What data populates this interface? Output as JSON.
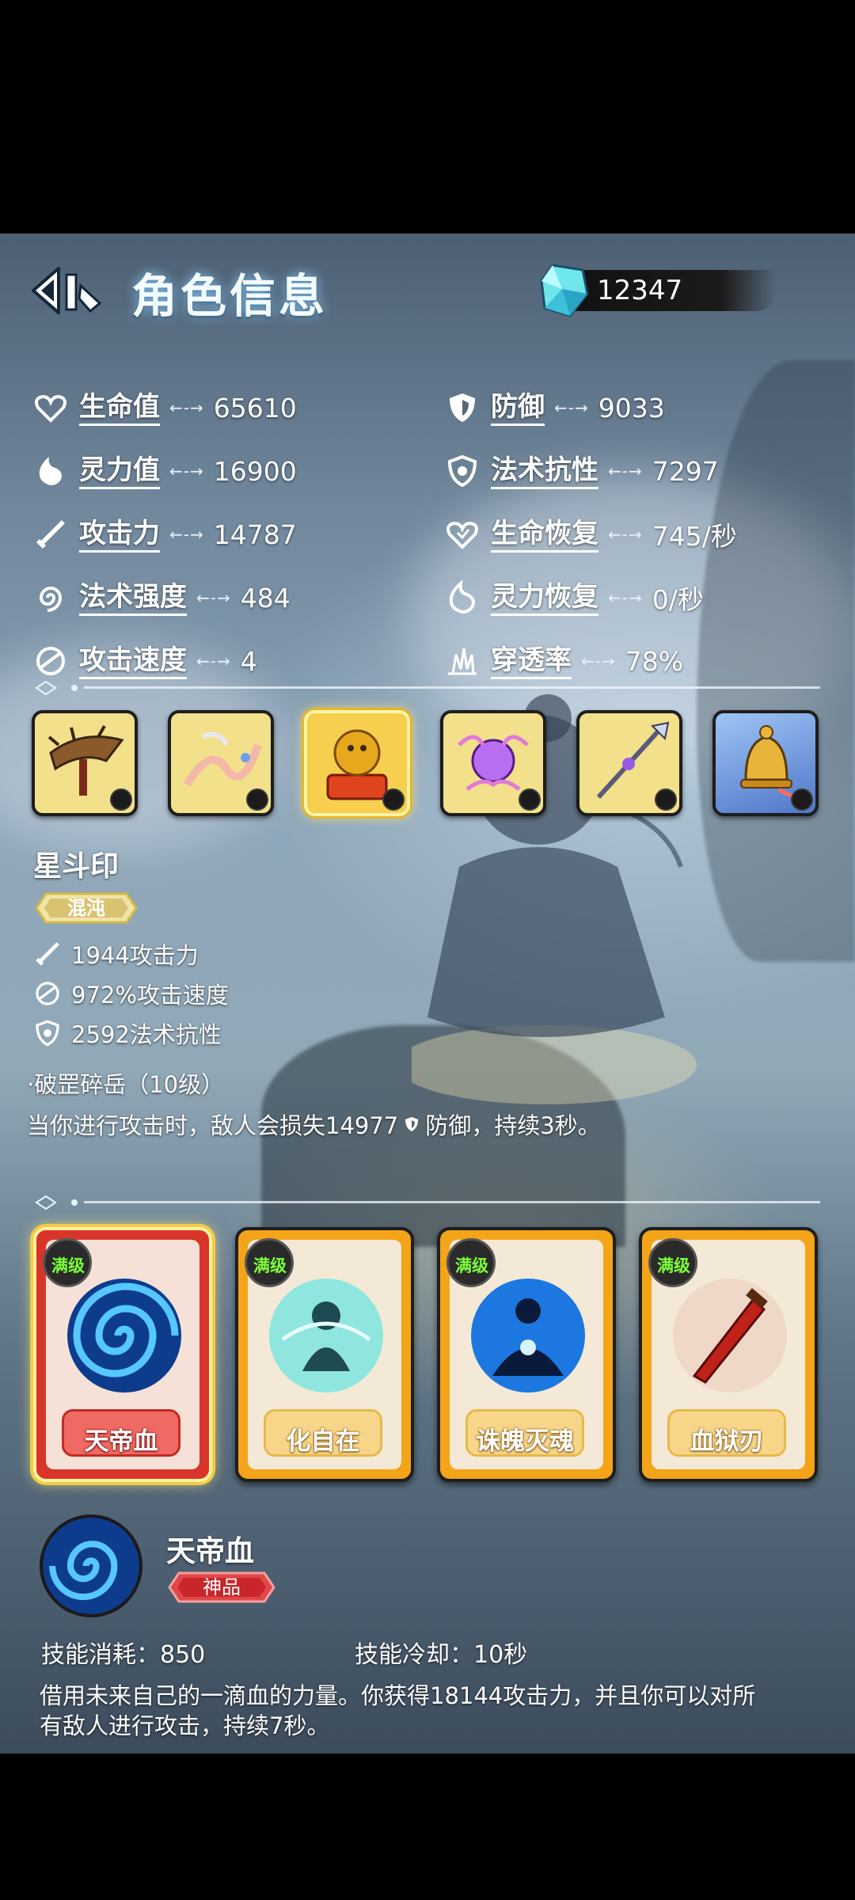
{
  "header": {
    "title": "角色信息",
    "currency_amount": "12347"
  },
  "stats": {
    "left": [
      {
        "label": "生命值",
        "value": "65610",
        "icon": "heart-icon"
      },
      {
        "label": "灵力值",
        "value": "16900",
        "icon": "flame-icon"
      },
      {
        "label": "攻击力",
        "value": "14787",
        "icon": "sword-icon"
      },
      {
        "label": "法术强度",
        "value": "484",
        "icon": "spiral-icon"
      },
      {
        "label": "攻击速度",
        "value": "4",
        "icon": "swift-icon"
      }
    ],
    "right": [
      {
        "label": "防御",
        "value": "9033",
        "icon": "shield-icon"
      },
      {
        "label": "法术抗性",
        "value": "7297",
        "icon": "magic-shield-icon"
      },
      {
        "label": "生命恢复",
        "value": "745/秒",
        "icon": "heart-regen-icon"
      },
      {
        "label": "灵力恢复",
        "value": "0/秒",
        "icon": "flame-regen-icon"
      },
      {
        "label": "穿透率",
        "value": "78%",
        "icon": "pierce-icon"
      }
    ]
  },
  "equipment": {
    "items": [
      {
        "icon": "crossbow-icon",
        "selected": false
      },
      {
        "icon": "ribbon-icon",
        "selected": false
      },
      {
        "icon": "golden-seal-icon",
        "selected": true
      },
      {
        "icon": "purple-orb-icon",
        "selected": false
      },
      {
        "icon": "spear-icon",
        "selected": false
      },
      {
        "icon": "bell-icon",
        "selected": false
      }
    ],
    "selected": {
      "name": "星斗印",
      "rarity": "混沌",
      "stats": [
        {
          "text": "1944攻击力",
          "icon": "sword-icon"
        },
        {
          "text": "972%攻击速度",
          "icon": "swift-icon"
        },
        {
          "text": "2592法术抗性",
          "icon": "magic-shield-icon"
        }
      ],
      "skill_title": "·破罡碎岳（10级）",
      "skill_desc_before": "当你进行攻击时，敌人会损失14977",
      "skill_desc_after": "防御，持续3秒。"
    }
  },
  "skills": {
    "cards": [
      {
        "name": "天帝血",
        "level": "满级",
        "selected": true,
        "icon": "blue-vortex-icon"
      },
      {
        "name": "化自在",
        "level": "满级",
        "selected": false,
        "icon": "cyan-spirit-icon"
      },
      {
        "name": "诛魄灭魂",
        "level": "满级",
        "selected": false,
        "icon": "blue-mage-icon"
      },
      {
        "name": "血狱刃",
        "level": "满级",
        "selected": false,
        "icon": "red-blade-icon"
      }
    ],
    "detail": {
      "name": "天帝血",
      "grade": "神品",
      "cost": "技能消耗：850",
      "cooldown": "技能冷却：10秒",
      "description": "借用未来自己的一滴血的力量。你获得18144攻击力，并且你可以对所有敌人进行攻击，持续7秒。"
    }
  },
  "colors": {
    "card_gold": "#f4a418",
    "card_selected": "#d8352a",
    "equip_bg": "#f2e08a",
    "level_text": "#7dff3a"
  }
}
